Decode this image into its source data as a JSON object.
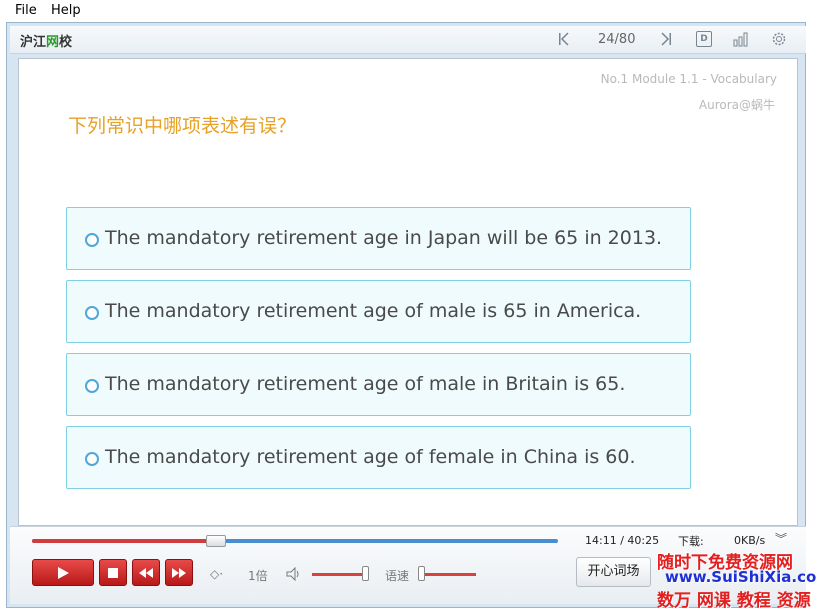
{
  "menu": {
    "file": "File",
    "help": "Help"
  },
  "toolbar": {
    "logo_part1": "沪江",
    "logo_part2": "网",
    "logo_part3": "校",
    "page_counter": "24/80",
    "icons": [
      "first-page-icon",
      "last-page-icon",
      "document-icon",
      "stats-icon",
      "settings-icon"
    ]
  },
  "lesson": {
    "module": "No.1 Module 1.1 - Vocabulary",
    "author": "Aurora@蜗牛",
    "question": "下列常识中哪项表述有误？",
    "options": [
      "The mandatory retirement age in Japan will be 65 in 2013.",
      "The mandatory retirement age of male is 65 in America.",
      "The mandatory retirement age of male in Britain is 65.",
      "The mandatory retirement age of female in China is 60."
    ]
  },
  "player": {
    "progress_fraction": 0.35,
    "time_current": "14:11",
    "time_total": "/ 40:25",
    "download_label": "下载:",
    "download_speed": "0KB/s",
    "rate_label": "1倍",
    "speed_label": "语速",
    "vocab_button": "开心词场"
  },
  "watermark": {
    "line1": "随时下免费资源网",
    "line2": "www.SuiShiXia.com",
    "line3": "数万 网课 教程 资源"
  },
  "colors": {
    "question": "#e7a126",
    "option_border": "#7fd0e3",
    "accent_red": "#d23c3c",
    "progress_blue": "#4a8ed0"
  }
}
